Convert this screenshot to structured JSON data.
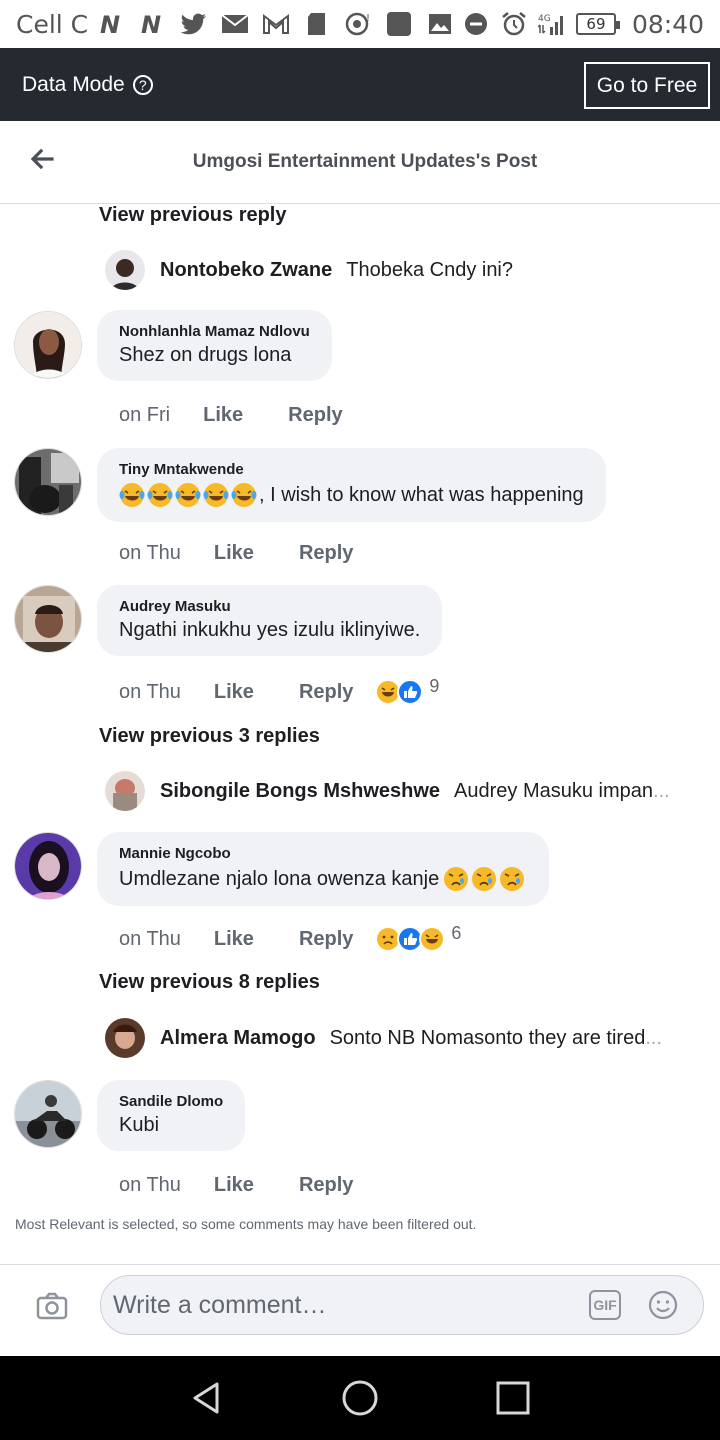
{
  "status_bar": {
    "carrier": "Cell C",
    "battery": "69",
    "time": "08:40",
    "network": "4G"
  },
  "data_mode": {
    "label": "Data Mode",
    "help": "?",
    "go_free": "Go to Free"
  },
  "header": {
    "title": "Umgosi Entertainment Updates's Post"
  },
  "thread": [
    {
      "type": "view_previous",
      "label": "View previous reply"
    },
    {
      "type": "reply",
      "name": "Nontobeko Zwane",
      "text": "Thobeka Cndy ini?"
    },
    {
      "type": "comment",
      "name": "Nonhlanhla Mamaz Ndlovu",
      "text": "Shez on drugs lona",
      "time": "on Fri",
      "like": "Like",
      "reply": "Reply"
    },
    {
      "type": "comment",
      "name": "Tiny Mntakwende",
      "text": ", I wish to know what was happening",
      "emoji_count": 5,
      "time": "on Thu",
      "like": "Like",
      "reply": "Reply"
    },
    {
      "type": "comment",
      "name": "Audrey Masuku",
      "text": "Ngathi inkukhu yes izulu iklinyiwe.",
      "time": "on Thu",
      "like": "Like",
      "reply": "Reply",
      "reaction_count": "9",
      "reactions": [
        "haha",
        "like"
      ]
    },
    {
      "type": "view_previous",
      "label": "View previous 3 replies"
    },
    {
      "type": "reply",
      "name": "Sibongile Bongs Mshweshwe",
      "text": "Audrey Masuku impan",
      "ellipsis": "..."
    },
    {
      "type": "comment",
      "name": "Mannie Ngcobo",
      "text": "Umdlezane njalo lona owenza kanje ",
      "time": "on Thu",
      "like": "Like",
      "reply": "Reply",
      "reaction_count": "6",
      "reactions": [
        "sad",
        "like",
        "haha"
      ]
    },
    {
      "type": "view_previous",
      "label": "View previous 8 replies"
    },
    {
      "type": "reply",
      "name": "Almera Mamogo",
      "text": "Sonto NB Nomasonto they are tired ",
      "ellipsis": "..."
    },
    {
      "type": "comment",
      "name": "Sandile Dlomo",
      "text": "Kubi",
      "time": "on Thu",
      "like": "Like",
      "reply": "Reply"
    }
  ],
  "filter_note": "Most Relevant is selected, so some comments may have been filtered out.",
  "composer": {
    "placeholder": "Write a comment…",
    "gif": "GIF"
  },
  "colors": {
    "data_mode_bg": "#252a31",
    "bubble_bg": "#f0f2f5",
    "like_blue": "#1877f2",
    "emoji_yellow": "#f7b928"
  }
}
